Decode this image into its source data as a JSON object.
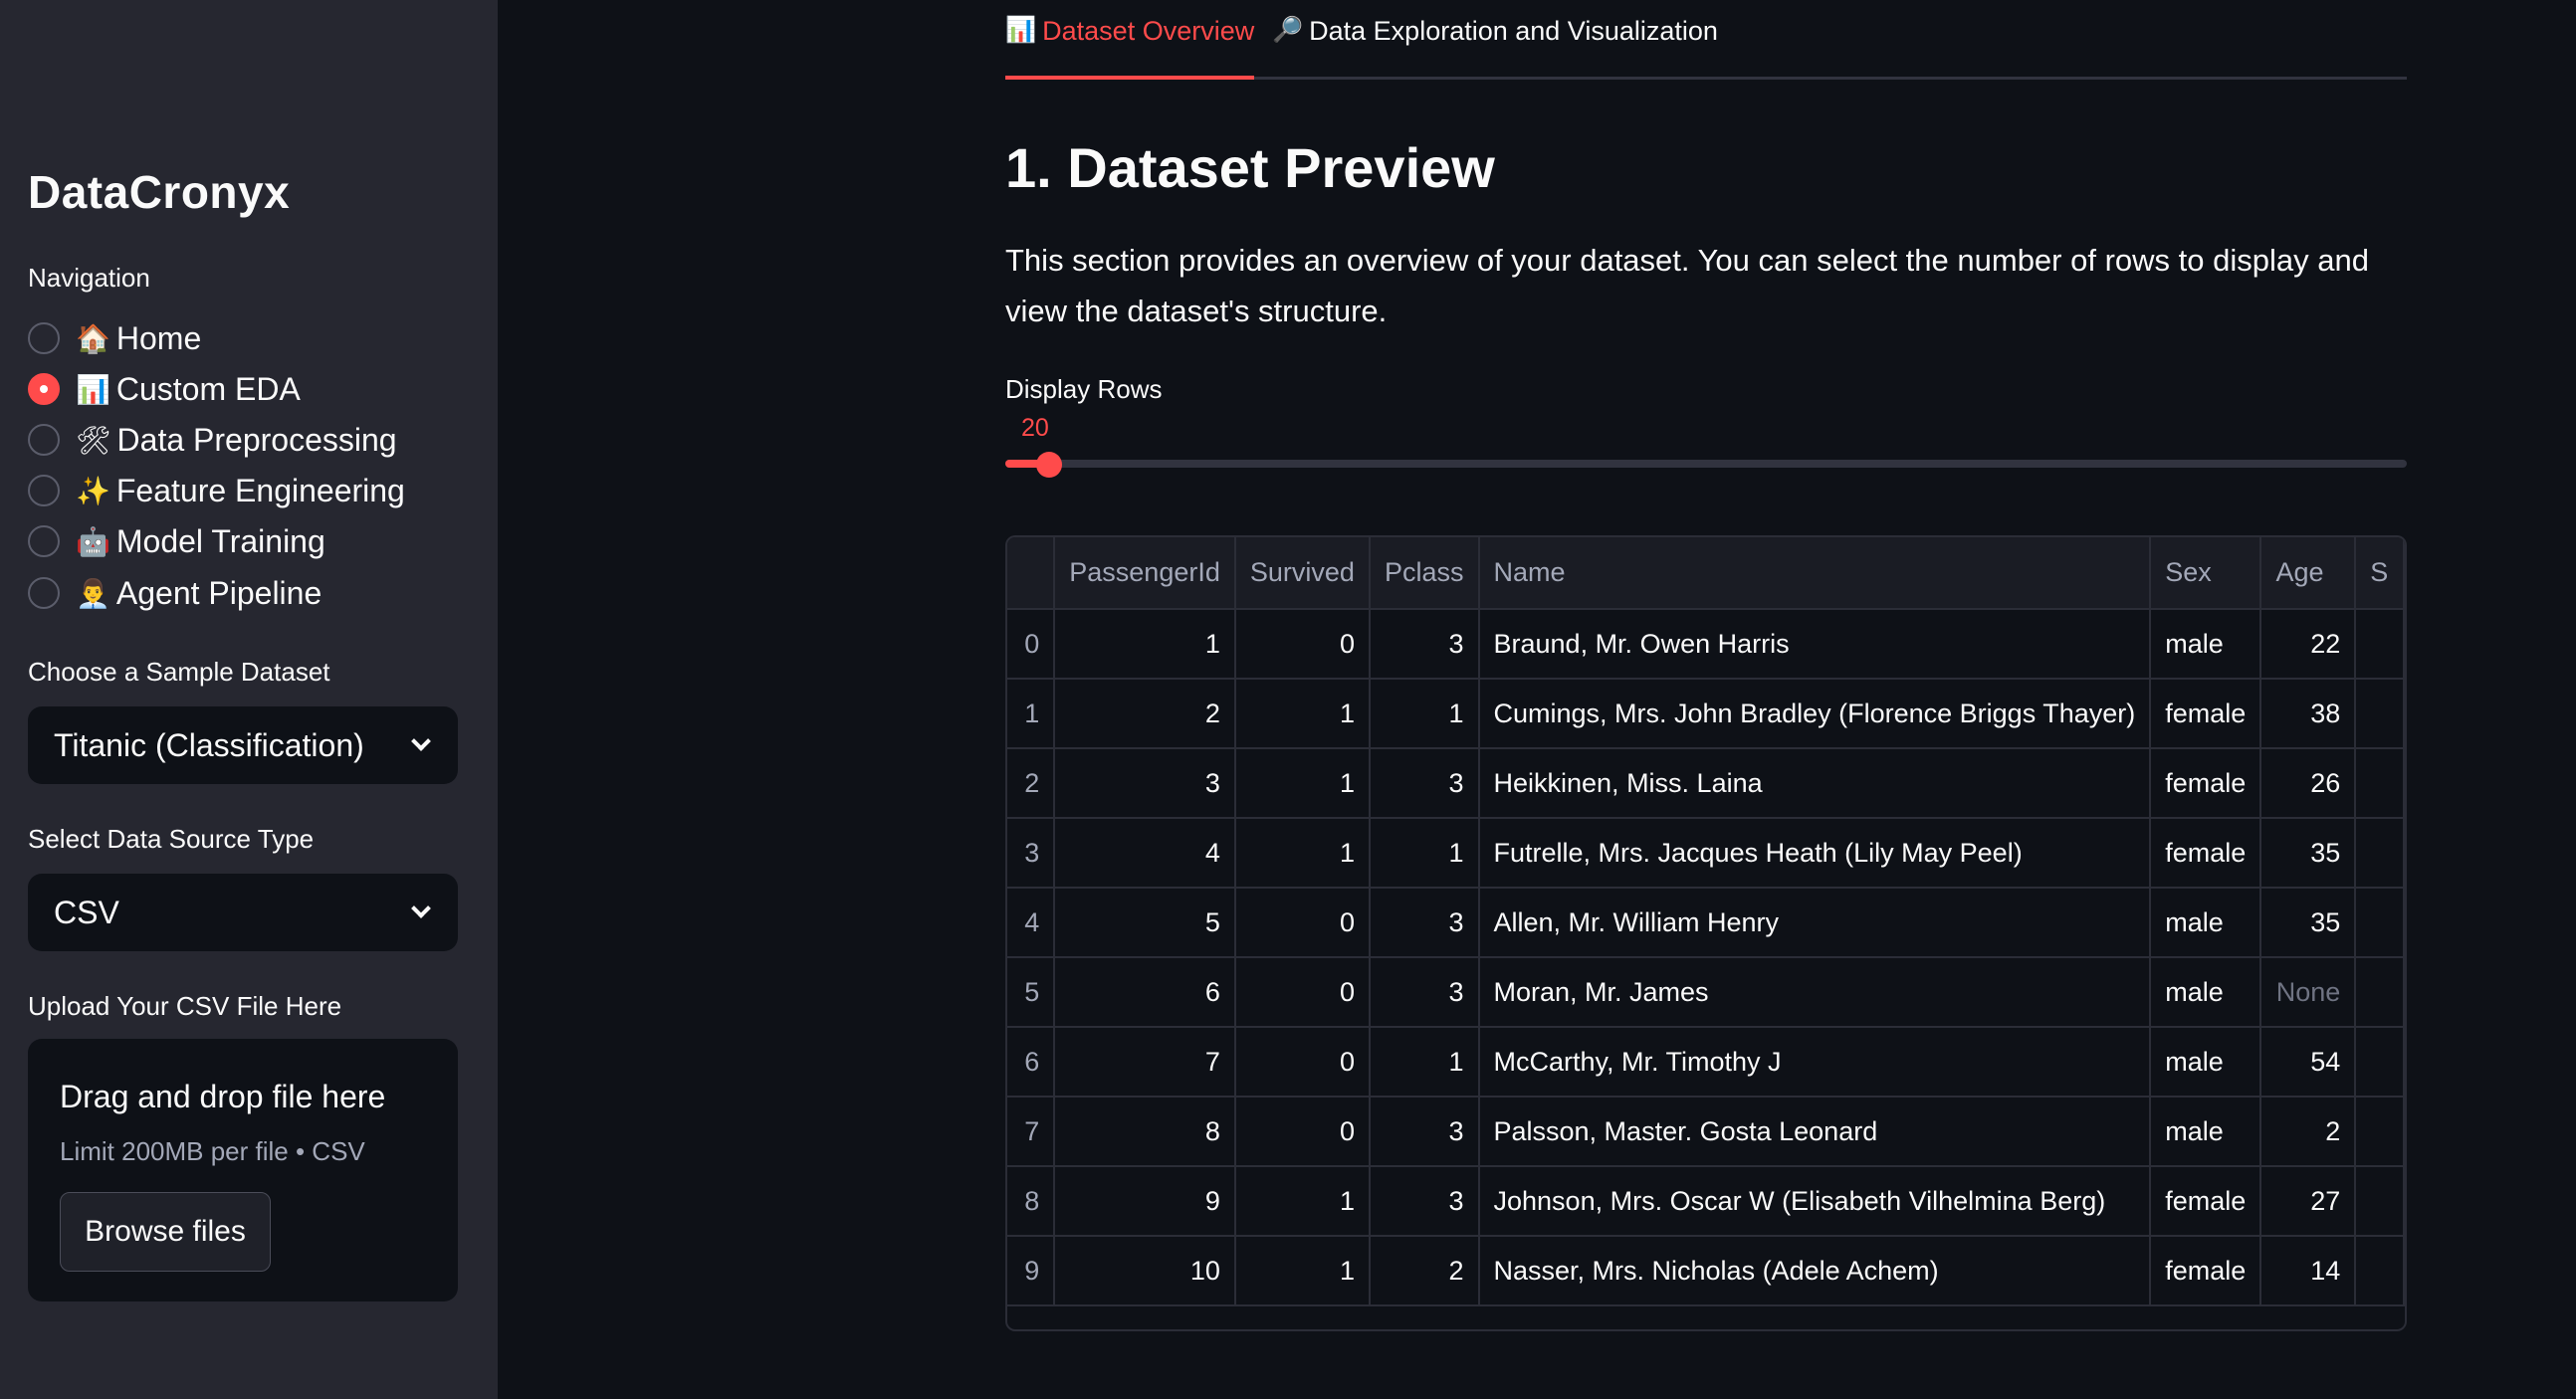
{
  "sidebar": {
    "app_title": "DataCronyx",
    "nav_label": "Navigation",
    "nav_items": [
      {
        "emoji": "🏠",
        "label": "Home",
        "selected": false
      },
      {
        "emoji": "📊",
        "label": "Custom EDA",
        "selected": true
      },
      {
        "emoji": "🛠",
        "label": "Data Preprocessing",
        "selected": false
      },
      {
        "emoji": "✨",
        "label": "Feature Engineering",
        "selected": false
      },
      {
        "emoji": "🤖",
        "label": "Model Training",
        "selected": false
      },
      {
        "emoji": "👨‍💼",
        "label": "Agent Pipeline",
        "selected": false
      }
    ],
    "sample_label": "Choose a Sample Dataset",
    "sample_value": "Titanic (Classification)",
    "source_label": "Select Data Source Type",
    "source_value": "CSV",
    "upload_label": "Upload Your CSV File Here",
    "upload_title": "Drag and drop file here",
    "upload_sub": "Limit 200MB per file • CSV",
    "browse_label": "Browse files"
  },
  "tabs": [
    {
      "emoji": "📊",
      "label": "Dataset Overview",
      "active": true
    },
    {
      "emoji": "🔎",
      "label": "Data Exploration and Visualization",
      "active": false
    }
  ],
  "section": {
    "heading": "1. Dataset Preview",
    "description": "This section provides an overview of your dataset. You can select the number of rows to display and view the dataset's structure."
  },
  "slider": {
    "label": "Display Rows",
    "value": "20",
    "fraction": 0.02
  },
  "accent": "#ff4b4b",
  "table": {
    "columns": [
      "",
      "PassengerId",
      "Survived",
      "Pclass",
      "Name",
      "Sex",
      "Age",
      "S"
    ],
    "rows": [
      [
        "0",
        "1",
        "0",
        "3",
        "Braund, Mr. Owen Harris",
        "male",
        "22"
      ],
      [
        "1",
        "2",
        "1",
        "1",
        "Cumings, Mrs. John Bradley (Florence Briggs Thayer)",
        "female",
        "38"
      ],
      [
        "2",
        "3",
        "1",
        "3",
        "Heikkinen, Miss. Laina",
        "female",
        "26"
      ],
      [
        "3",
        "4",
        "1",
        "1",
        "Futrelle, Mrs. Jacques Heath (Lily May Peel)",
        "female",
        "35"
      ],
      [
        "4",
        "5",
        "0",
        "3",
        "Allen, Mr. William Henry",
        "male",
        "35"
      ],
      [
        "5",
        "6",
        "0",
        "3",
        "Moran, Mr. James",
        "male",
        "None"
      ],
      [
        "6",
        "7",
        "0",
        "1",
        "McCarthy, Mr. Timothy J",
        "male",
        "54"
      ],
      [
        "7",
        "8",
        "0",
        "3",
        "Palsson, Master. Gosta Leonard",
        "male",
        "2"
      ],
      [
        "8",
        "9",
        "1",
        "3",
        "Johnson, Mrs. Oscar W (Elisabeth Vilhelmina Berg)",
        "female",
        "27"
      ],
      [
        "9",
        "10",
        "1",
        "2",
        "Nasser, Mrs. Nicholas (Adele Achem)",
        "female",
        "14"
      ]
    ]
  }
}
